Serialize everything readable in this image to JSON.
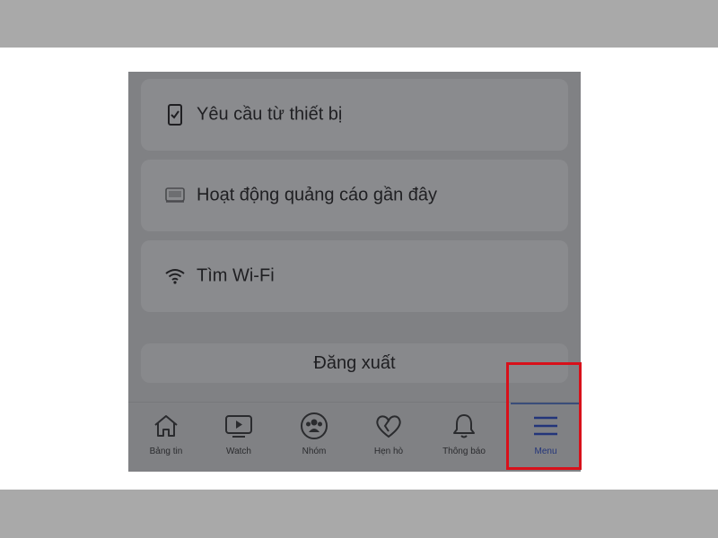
{
  "menu_items": [
    {
      "label": "Yêu cầu từ thiết bị",
      "icon": "phone-check-icon"
    },
    {
      "label": "Hoạt động quảng cáo gần đây",
      "icon": "ad-activity-icon"
    },
    {
      "label": "Tìm Wi-Fi",
      "icon": "wifi-icon"
    }
  ],
  "logout_label": "Đăng xuất",
  "tabs": [
    {
      "label": "Bảng tin",
      "icon": "home-icon"
    },
    {
      "label": "Watch",
      "icon": "video-icon"
    },
    {
      "label": "Nhóm",
      "icon": "groups-icon"
    },
    {
      "label": "Hẹn hò",
      "icon": "heart-icon"
    },
    {
      "label": "Thông báo",
      "icon": "bell-icon"
    },
    {
      "label": "Menu",
      "icon": "hamburger-menu-icon",
      "active": true
    }
  ],
  "colors": {
    "overlay": "#808184",
    "highlight": "#d8101a",
    "active_tab": "#23357a"
  }
}
